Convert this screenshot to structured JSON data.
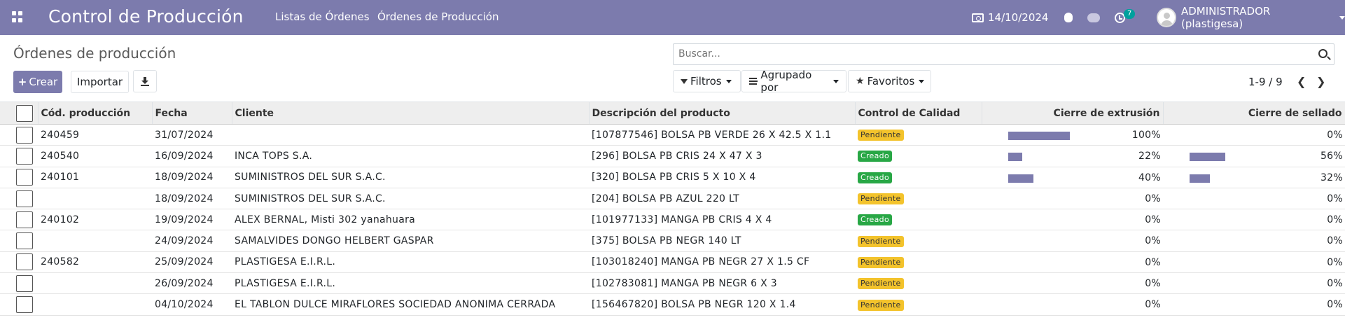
{
  "navbar": {
    "app_title": "Control de Producción",
    "menu": [
      "Listas de Órdenes",
      "Órdenes de Producción"
    ],
    "date": "14/10/2024",
    "activity_count": "7",
    "user": "ADMINISTRADOR (plastigesa)",
    "bg_color": "#7c7bad"
  },
  "control_panel": {
    "title": "Órdenes de producción",
    "search_placeholder": "Buscar...",
    "create_label": "Crear",
    "import_label": "Importar",
    "filters_label": "Filtros",
    "groupby_label": "Agrupado por",
    "favorites_label": "Favoritos",
    "pager": "1-9 / 9"
  },
  "table": {
    "headers": {
      "code": "Cód. producción",
      "date": "Fecha",
      "client": "Cliente",
      "product": "Descripción del producto",
      "quality": "Control de Calidad",
      "extrusion": "Cierre de extrusión",
      "sealing": "Cierre de sellado"
    },
    "rows": [
      {
        "code": "240459",
        "date": "31/07/2024",
        "client": "",
        "product": "[107877546] BOLSA PB VERDE 26 X 42.5 X 1.1",
        "quality": "Pendiente",
        "extrusion": "100%",
        "extrusion_fill": 0.8,
        "sealing": "0%",
        "sealing_fill": 0
      },
      {
        "code": "240540",
        "date": "16/09/2024",
        "client": "INCA TOPS S.A.",
        "product": "[296] BOLSA PB CRIS 24 X 47 X 3",
        "quality": "Creado",
        "extrusion": "22%",
        "extrusion_fill": 0.18,
        "sealing": "56%",
        "sealing_fill": 0.46
      },
      {
        "code": "240101",
        "date": "18/09/2024",
        "client": "SUMINISTROS DEL SUR S.A.C.",
        "product": "[320] BOLSA PB CRIS 5 X 10 X 4",
        "quality": "Creado",
        "extrusion": "40%",
        "extrusion_fill": 0.33,
        "sealing": "32%",
        "sealing_fill": 0.26
      },
      {
        "code": "",
        "date": "18/09/2024",
        "client": "SUMINISTROS DEL SUR S.A.C.",
        "product": "[204] BOLSA PB AZUL 220 LT",
        "quality": "Pendiente",
        "extrusion": "0%",
        "extrusion_fill": 0,
        "sealing": "0%",
        "sealing_fill": 0
      },
      {
        "code": "240102",
        "date": "19/09/2024",
        "client": "ALEX BERNAL, Misti 302 yanahuara",
        "product": "[101977133] MANGA PB CRIS 4 X 4",
        "quality": "Creado",
        "extrusion": "0%",
        "extrusion_fill": 0,
        "sealing": "0%",
        "sealing_fill": 0
      },
      {
        "code": "",
        "date": "24/09/2024",
        "client": "SAMALVIDES DONGO HELBERT GASPAR",
        "product": "[375] BOLSA PB NEGR 140 LT",
        "quality": "Pendiente",
        "extrusion": "0%",
        "extrusion_fill": 0,
        "sealing": "0%",
        "sealing_fill": 0
      },
      {
        "code": "240582",
        "date": "25/09/2024",
        "client": "PLASTIGESA E.I.R.L.",
        "product": "[103018240] MANGA PB NEGR 27 X 1.5 CF",
        "quality": "Pendiente",
        "extrusion": "0%",
        "extrusion_fill": 0,
        "sealing": "0%",
        "sealing_fill": 0
      },
      {
        "code": "",
        "date": "26/09/2024",
        "client": "PLASTIGESA E.I.R.L.",
        "product": "[102783081] MANGA PB NEGR 6 X 3",
        "quality": "Pendiente",
        "extrusion": "0%",
        "extrusion_fill": 0,
        "sealing": "0%",
        "sealing_fill": 0
      },
      {
        "code": "",
        "date": "04/10/2024",
        "client": "EL TABLON DULCE MIRAFLORES SOCIEDAD ANONIMA CERRADA",
        "product": "[156467820] BOLSA PB NEGR 120 X 1.4",
        "quality": "Pendiente",
        "extrusion": "0%",
        "extrusion_fill": 0,
        "sealing": "0%",
        "sealing_fill": 0
      }
    ]
  },
  "colors": {
    "accent": "#7c7bad",
    "pending": "#f3c32c",
    "created": "#28a745"
  }
}
